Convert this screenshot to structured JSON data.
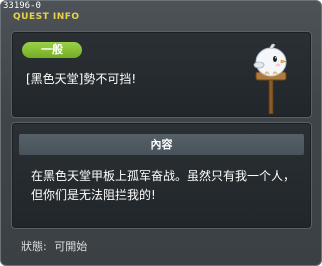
{
  "window": {
    "quest_id": "33196-0",
    "title": "QUEST INFO"
  },
  "info": {
    "category": "一般",
    "quest_name": "[黑色天堂]勢不可挡!",
    "npc_icon": "bird-npc-on-sign-icon"
  },
  "description": {
    "header": "內容",
    "lines": [
      "在黑色天堂甲板上孤军奋战。虽然只有我一个人，",
      "但你们是无法阻拦我的!"
    ]
  },
  "status": {
    "label": "狀態:",
    "value": "可開始"
  },
  "colors": {
    "title": "#e7d34a",
    "badge": "#8cc63f",
    "panel_bg": "#23292d",
    "window_bg": "#42484c"
  }
}
